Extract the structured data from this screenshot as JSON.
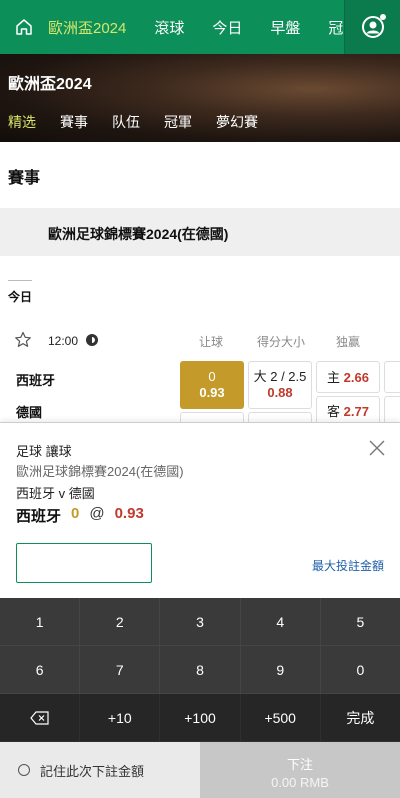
{
  "nav": {
    "tabs": [
      "歐洲盃2024",
      "滾球",
      "今日",
      "早盤",
      "冠"
    ],
    "active_tab": 0
  },
  "banner": {
    "title": "歐洲盃2024",
    "subtabs": [
      "精选",
      "賽事",
      "队伍",
      "冠軍",
      "夢幻賽"
    ]
  },
  "section_title": "賽事",
  "league": {
    "name": "歐洲足球錦標賽2024(在德國)"
  },
  "day_label": "今日",
  "match": {
    "time": "12:00",
    "col_headers": [
      "让球",
      "得分大小",
      "独赢"
    ],
    "home": "西班牙",
    "away": "德國",
    "handicap_home": {
      "line": "0",
      "odds": "0.93"
    },
    "ou_over": {
      "line": "大 2 / 2.5",
      "odds": "0.88"
    },
    "ml_home": {
      "label": "主",
      "odds": "2.66"
    },
    "ml_away": {
      "label": "客",
      "odds": "2.77"
    }
  },
  "slip": {
    "market": "足球 讓球",
    "league": "歐洲足球錦標賽2024(在德國)",
    "match": "西班牙 v 德國",
    "pick_team": "西班牙",
    "pick_line": "0",
    "at": "@",
    "pick_odds": "0.93",
    "max_stake_label": "最大投註金額"
  },
  "keypad": {
    "row1": [
      "1",
      "2",
      "3",
      "4",
      "5"
    ],
    "row2": [
      "6",
      "7",
      "8",
      "9",
      "0"
    ],
    "row3": [
      "⌫",
      "+10",
      "+100",
      "+500",
      "完成"
    ]
  },
  "footer": {
    "remember_label": "記住此次下註金額",
    "place_label": "下注",
    "place_amount": "0.00 RMB"
  },
  "colors": {
    "brand_green": "#0d8f5a",
    "selected_gold": "#c49a2a",
    "odds_red": "#c0392b"
  }
}
